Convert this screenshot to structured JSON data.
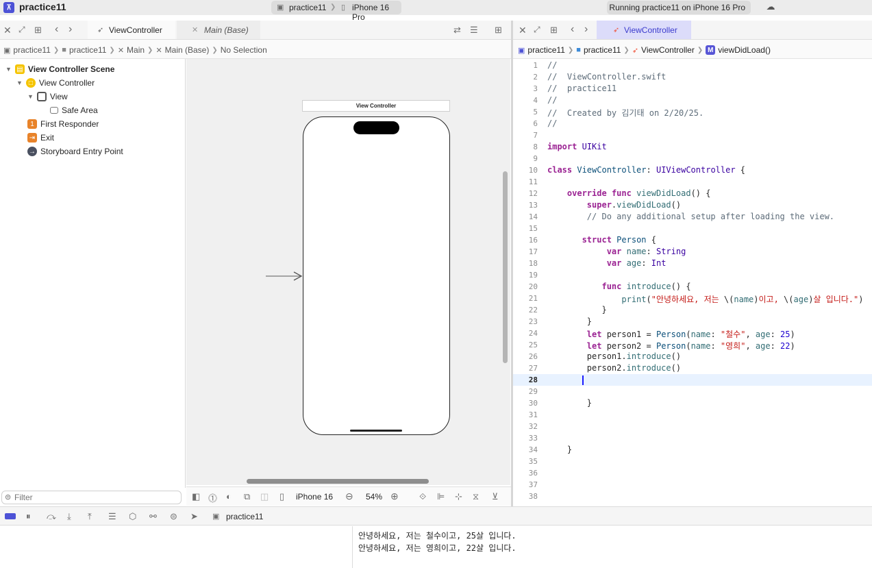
{
  "titlebar": {
    "app_title": "practice11",
    "scheme": "practice11",
    "destination": "iPhone 16 Pro",
    "status": "Running practice11 on iPhone 16 Pro"
  },
  "left_editor": {
    "tabs": [
      {
        "label": "ViewController",
        "active": true
      },
      {
        "label": "Main (Base)",
        "active": false
      }
    ],
    "path": [
      "practice11",
      "practice11",
      "Main",
      "Main (Base)",
      "No Selection"
    ]
  },
  "outline": {
    "items": [
      {
        "label": "View Controller Scene",
        "level": 0
      },
      {
        "label": "View Controller",
        "level": 1
      },
      {
        "label": "View",
        "level": 2
      },
      {
        "label": "Safe Area",
        "level": 3
      },
      {
        "label": "First Responder",
        "level": 1
      },
      {
        "label": "Exit",
        "level": 1
      },
      {
        "label": "Storyboard Entry Point",
        "level": 1
      }
    ],
    "filter_placeholder": "Filter",
    "first_responder_badge": "1"
  },
  "canvas": {
    "scene_title": "View Controller",
    "device": "iPhone 16",
    "zoom": "54%"
  },
  "right_editor": {
    "tab": "ViewController",
    "path": [
      "practice11",
      "practice11",
      "ViewController",
      "viewDidLoad()"
    ],
    "method_badge": "M",
    "current_line": 28
  },
  "code_lines": [
    "//",
    "//  ViewController.swift",
    "//  practice11",
    "//",
    "//  Created by 김기태 on 2/20/25.",
    "//",
    "",
    "import UIKit",
    "",
    "class ViewController: UIViewController {",
    "",
    "    override func viewDidLoad() {",
    "        super.viewDidLoad()",
    "        // Do any additional setup after loading the view.",
    "",
    "       struct Person {",
    "            var name: String",
    "            var age: Int",
    "",
    "           func introduce() {",
    "               print(\"안녕하세요, 저는 \\(name)이고, \\(age)살 입니다.\")",
    "           }",
    "        }",
    "        let person1 = Person(name: \"철수\", age: 25)",
    "        let person2 = Person(name: \"영희\", age: 22)",
    "        person1.introduce()",
    "        person2.introduce()",
    "",
    "",
    "        }",
    "",
    "",
    "",
    "    }",
    "",
    "",
    "",
    ""
  ],
  "debugbar": {
    "target": "practice11"
  },
  "console": {
    "lines": [
      "안녕하세요, 저는 철수이고, 25살 입니다.",
      "안녕하세요, 저는 영희이고, 22살 입니다."
    ]
  },
  "colors": {
    "accent": "#4d52d6",
    "keyword": "#9b2393",
    "string": "#c41a16",
    "number": "#1c00cf",
    "comment": "#5d6c79",
    "current_line_bg": "#e8f2ff"
  }
}
